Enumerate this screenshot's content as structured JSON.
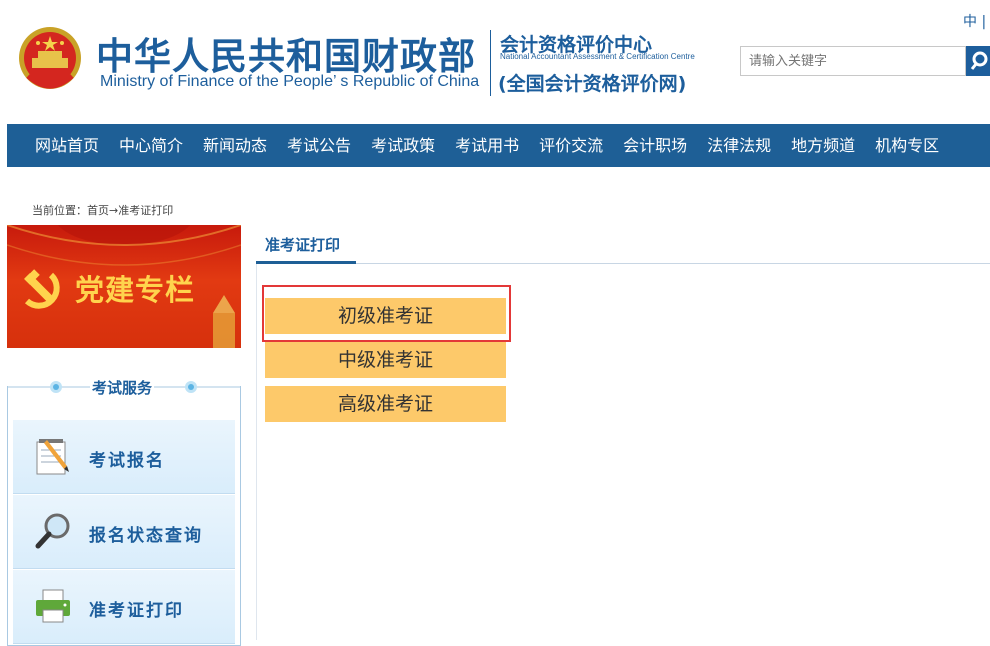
{
  "header": {
    "ministry_cn": "中华人民共和国财政部",
    "ministry_en": "Ministry of Finance of the People’ s Republic of China",
    "center_cn": "会计资格评价中心",
    "center_en": "National Accountant Assessment & Certification Centre",
    "site_cn": "(全国会计资格评价网)",
    "lang": "中 |",
    "search_placeholder": "请输入关键字",
    "emblem_icon": "national-emblem-icon",
    "brand_color": "#1d5e9c"
  },
  "nav": {
    "items": [
      "网站首页",
      "中心简介",
      "新闻动态",
      "考试公告",
      "考试政策",
      "考试用书",
      "评价交流",
      "会计职场",
      "法律法规",
      "地方频道",
      "机构专区"
    ],
    "bg_color": "#1e5f96"
  },
  "breadcrumb": "当前位置：首页→准考证打印",
  "party_banner": {
    "text": "党建专栏"
  },
  "services": {
    "title": "考试服务",
    "items": [
      {
        "label": "考试报名",
        "icon": "notepad-pencil-icon"
      },
      {
        "label": "报名状态查询",
        "icon": "magnifier-icon"
      },
      {
        "label": "准考证打印",
        "icon": "printer-icon"
      }
    ]
  },
  "main": {
    "title": "准考证打印",
    "buttons": [
      "初级准考证",
      "中级准考证",
      "高级准考证"
    ],
    "button_color": "#fdc96a",
    "highlight_color": "#e33838"
  }
}
